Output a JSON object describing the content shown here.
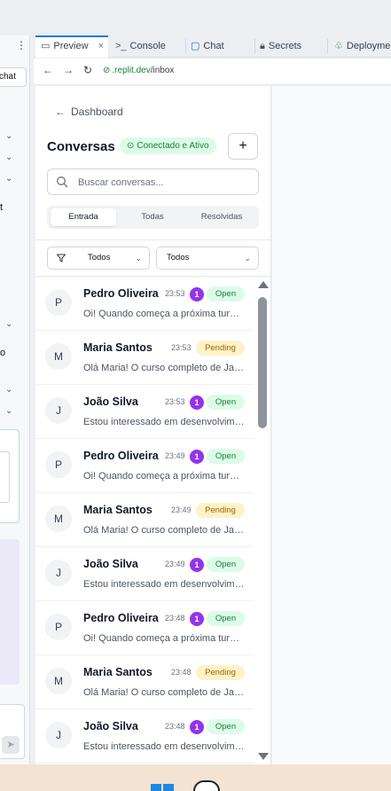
{
  "left_panel": {
    "chat_label": "chat",
    "text_fragments": [
      "t",
      "o"
    ]
  },
  "tabs": [
    {
      "label": "Preview",
      "icon": "monitor-icon",
      "active": true
    },
    {
      "label": "Console",
      "icon": "terminal-icon",
      "active": false
    },
    {
      "label": "Chat",
      "icon": "chat-bubble-icon",
      "active": false
    },
    {
      "label": "Secrets",
      "icon": "lock-icon",
      "active": false
    },
    {
      "label": "Deployme",
      "icon": "deploy-icon",
      "active": false
    }
  ],
  "url": {
    "domain": ".replit.dev",
    "path": "/inbox"
  },
  "inbox": {
    "back_label": "Dashboard",
    "title": "Conversas",
    "status": "Conectado e Ativo",
    "new_button": "+",
    "search": {
      "placeholder": "Buscar conversas..."
    },
    "segments": [
      "Entrada",
      "Todas",
      "Resolvidas"
    ],
    "active_segment": "Entrada",
    "filter1": "Todos",
    "filter2": "Todos",
    "colors": {
      "accent": "#0079f2",
      "count_badge": "#9333ea",
      "open_bg": "#dcfce7",
      "pending_bg": "#fef3c7"
    },
    "conversations": [
      {
        "initial": "P",
        "name": "Pedro Oliveira",
        "time": "23:53",
        "unread": "1",
        "status": "Open",
        "preview": "Oi! Quando começa a próxima turma?"
      },
      {
        "initial": "M",
        "name": "Maria Santos",
        "time": "23:53",
        "unread": null,
        "status": "Pending",
        "preview": "Olá Maria! O curso completo de JavaScript"
      },
      {
        "initial": "J",
        "name": "João Silva",
        "time": "23:53",
        "unread": "1",
        "status": "Open",
        "preview": "Estou interessado em desenvolvimento web"
      },
      {
        "initial": "P",
        "name": "Pedro Oliveira",
        "time": "23:49",
        "unread": "1",
        "status": "Open",
        "preview": "Oi! Quando começa a próxima turma?"
      },
      {
        "initial": "M",
        "name": "Maria Santos",
        "time": "23:49",
        "unread": null,
        "status": "Pending",
        "preview": "Olá Maria! O curso completo de JavaScript"
      },
      {
        "initial": "J",
        "name": "João Silva",
        "time": "23:49",
        "unread": "1",
        "status": "Open",
        "preview": "Estou interessado em desenvolvimento web"
      },
      {
        "initial": "P",
        "name": "Pedro Oliveira",
        "time": "23:48",
        "unread": "1",
        "status": "Open",
        "preview": "Oi! Quando começa a próxima turma?"
      },
      {
        "initial": "M",
        "name": "Maria Santos",
        "time": "23:48",
        "unread": null,
        "status": "Pending",
        "preview": "Olá Maria! O curso completo de JavaScript"
      },
      {
        "initial": "J",
        "name": "João Silva",
        "time": "23:48",
        "unread": "1",
        "status": "Open",
        "preview": "Estou interessado em desenvolvimento web"
      }
    ]
  }
}
